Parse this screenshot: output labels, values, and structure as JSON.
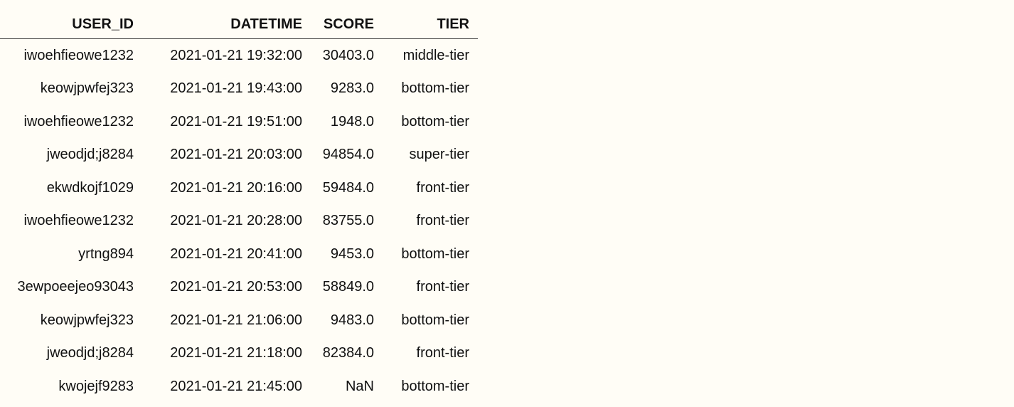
{
  "table": {
    "headers": [
      "USER_ID",
      "DATETIME",
      "SCORE",
      "TIER"
    ],
    "rows": [
      [
        "iwoehfieowe1232",
        "2021-01-21 19:32:00",
        "30403.0",
        "middle-tier"
      ],
      [
        "keowjpwfej323",
        "2021-01-21 19:43:00",
        "9283.0",
        "bottom-tier"
      ],
      [
        "iwoehfieowe1232",
        "2021-01-21 19:51:00",
        "1948.0",
        "bottom-tier"
      ],
      [
        "jweodjd;j8284",
        "2021-01-21 20:03:00",
        "94854.0",
        "super-tier"
      ],
      [
        "ekwdkojf1029",
        "2021-01-21 20:16:00",
        "59484.0",
        "front-tier"
      ],
      [
        "iwoehfieowe1232",
        "2021-01-21 20:28:00",
        "83755.0",
        "front-tier"
      ],
      [
        "yrtng894",
        "2021-01-21 20:41:00",
        "9453.0",
        "bottom-tier"
      ],
      [
        "3ewpoeejeo93043",
        "2021-01-21 20:53:00",
        "58849.0",
        "front-tier"
      ],
      [
        "keowjpwfej323",
        "2021-01-21 21:06:00",
        "9483.0",
        "bottom-tier"
      ],
      [
        "jweodjd;j8284",
        "2021-01-21 21:18:00",
        "82384.0",
        "front-tier"
      ],
      [
        "kwojejf9283",
        "2021-01-21 21:45:00",
        "NaN",
        "bottom-tier"
      ]
    ]
  }
}
